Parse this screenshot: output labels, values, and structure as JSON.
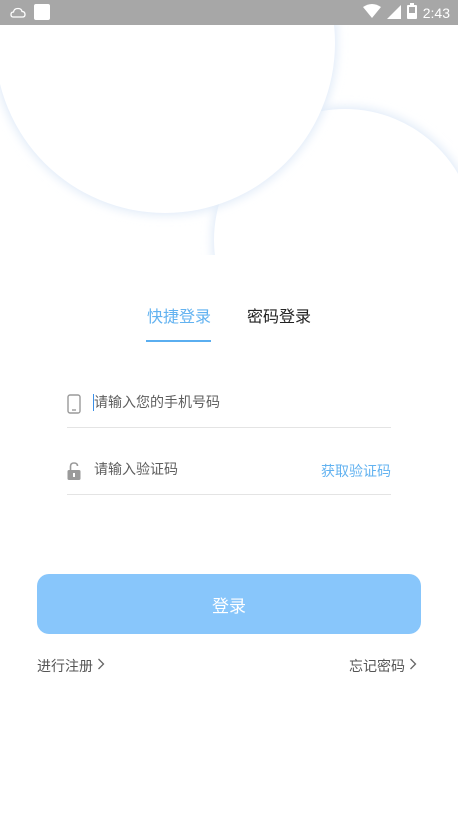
{
  "status_bar": {
    "time": "2:43",
    "icons": [
      "notification-icon",
      "square-icon",
      "wifi-icon",
      "signal-icon",
      "battery-icon"
    ]
  },
  "tabs": [
    {
      "label": "快捷登录",
      "active": true
    },
    {
      "label": "密码登录",
      "active": false
    }
  ],
  "phone_field": {
    "placeholder": "请输入您的手机号码",
    "value": ""
  },
  "code_field": {
    "placeholder": "请输入验证码",
    "value": "",
    "get_code_label": "获取验证码"
  },
  "login_button": {
    "label": "登录"
  },
  "links": {
    "register": "进行注册",
    "forgot_password": "忘记密码"
  },
  "colors": {
    "accent": "#62b2f0",
    "button": "#88c6fb",
    "status_bar": "#a7a7a7"
  }
}
